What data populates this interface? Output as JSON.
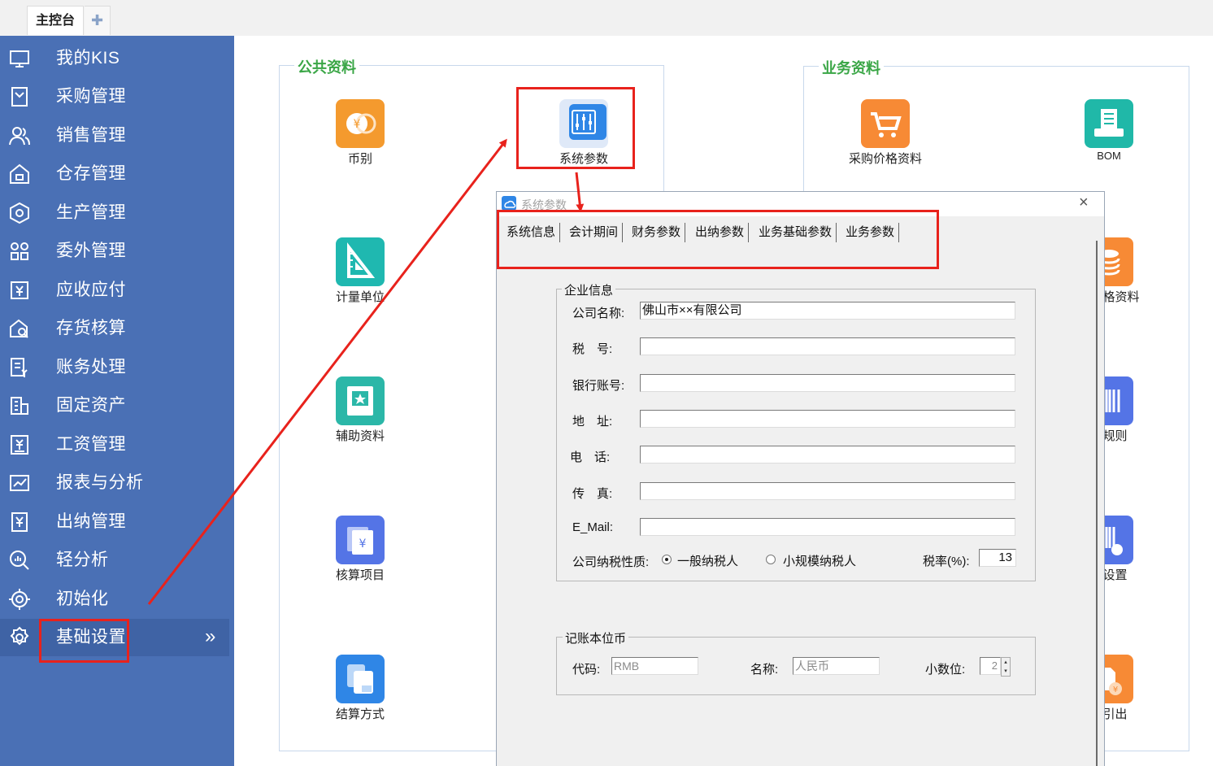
{
  "tabs": {
    "main": "主控台",
    "add_icon": "plus-icon"
  },
  "sidebar": {
    "items": [
      {
        "label": "我的KIS",
        "icon": "monitor-icon"
      },
      {
        "label": "采购管理",
        "icon": "bookmark-icon"
      },
      {
        "label": "销售管理",
        "icon": "users-icon"
      },
      {
        "label": "仓存管理",
        "icon": "warehouse-icon"
      },
      {
        "label": "生产管理",
        "icon": "gear-hex-icon"
      },
      {
        "label": "委外管理",
        "icon": "grid-icon"
      },
      {
        "label": "应收应付",
        "icon": "yen-exchange-icon"
      },
      {
        "label": "存货核算",
        "icon": "inventory-search-icon"
      },
      {
        "label": "账务处理",
        "icon": "ledger-icon"
      },
      {
        "label": "固定资产",
        "icon": "building-icon"
      },
      {
        "label": "工资管理",
        "icon": "salary-icon"
      },
      {
        "label": "报表与分析",
        "icon": "chart-icon"
      },
      {
        "label": "出纳管理",
        "icon": "cashier-icon"
      },
      {
        "label": "轻分析",
        "icon": "magnify-chart-icon"
      },
      {
        "label": "初始化",
        "icon": "target-icon"
      },
      {
        "label": "基础设置",
        "icon": "settings-icon"
      }
    ],
    "active_chevron": "»"
  },
  "public": {
    "title": "公共资料",
    "apps": [
      {
        "label": "币别",
        "icon": "currency-icon"
      },
      {
        "label": "系统参数",
        "icon": "system-params-icon"
      },
      {
        "label": "计量单位",
        "icon": "ruler-icon"
      },
      {
        "label": "辅助资料",
        "icon": "book-star-icon"
      },
      {
        "label": "核算项目",
        "icon": "accounting-item-icon"
      },
      {
        "label": "结算方式",
        "icon": "settlement-icon"
      }
    ]
  },
  "business": {
    "title": "业务资料",
    "apps": [
      {
        "label": "采购价格资料",
        "icon": "cart-icon"
      },
      {
        "label": "BOM",
        "icon": "bom-icon"
      },
      {
        "label": "售价格资料",
        "icon": "coins-icon"
      },
      {
        "label": "码规则",
        "icon": "barcode-icon"
      },
      {
        "label": "码设置",
        "icon": "barcode-settings-icon"
      },
      {
        "label": "入引出",
        "icon": "import-export-icon"
      }
    ]
  },
  "dialog": {
    "title": "系统参数",
    "close": "×",
    "tabs": [
      "系统信息",
      "会计期间",
      "财务参数",
      "出纳参数",
      "业务基础参数",
      "业务参数"
    ],
    "company": {
      "legend": "企业信息",
      "fields": [
        {
          "label": "公司名称:",
          "value": "佛山市××有限公司"
        },
        {
          "label": "税　号:",
          "value": ""
        },
        {
          "label": "银行账号:",
          "value": ""
        },
        {
          "label": "地　址:",
          "value": ""
        },
        {
          "label": "电　话:",
          "value": ""
        },
        {
          "label": "传　真:",
          "value": ""
        },
        {
          "label": "E_Mail:",
          "value": ""
        }
      ],
      "tax_type_label": "公司纳税性质:",
      "tax_options": [
        "一般纳税人",
        "小规模纳税人"
      ],
      "tax_rate_label": "税率(%):",
      "tax_rate": "13"
    },
    "currency": {
      "legend": "记账本位币",
      "code_label": "代码:",
      "code": "RMB",
      "name_label": "名称:",
      "name": "人民币",
      "decimal_label": "小数位:",
      "decimal": "2"
    }
  }
}
